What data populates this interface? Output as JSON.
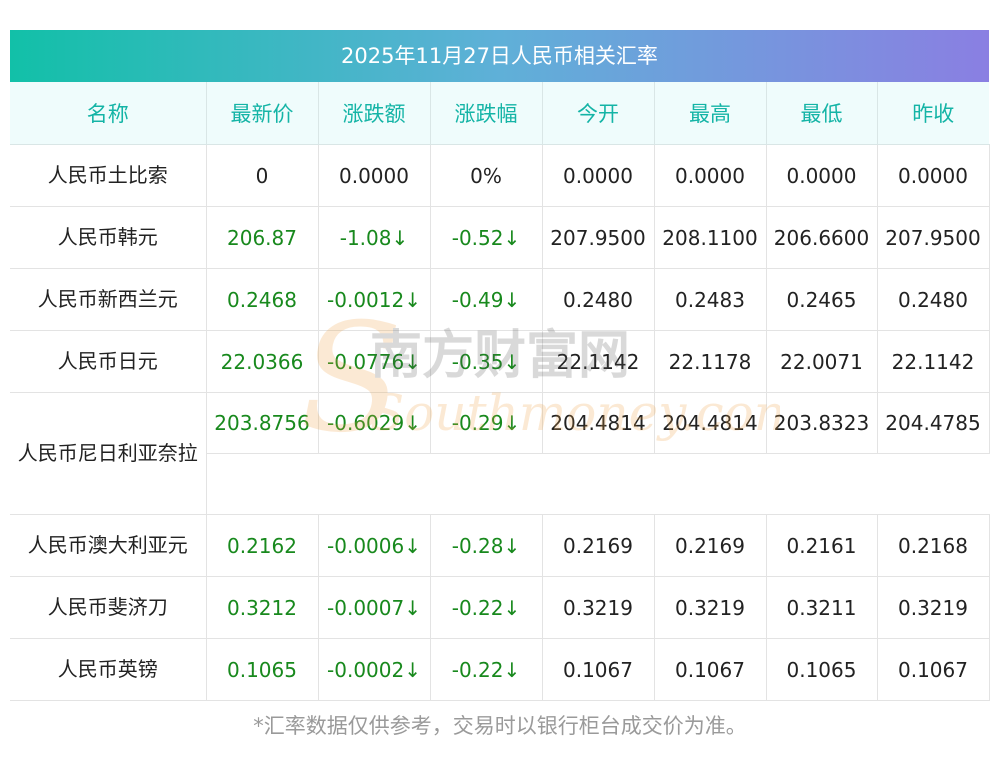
{
  "title": "2025年11月27日人民币相关汇率",
  "columns": [
    "名称",
    "最新价",
    "涨跌额",
    "涨跌幅",
    "今开",
    "最高",
    "最低",
    "昨收"
  ],
  "rows": [
    {
      "name": "人民币土比索",
      "latest": "0",
      "change": "0.0000",
      "pct": "0%",
      "open": "0.0000",
      "high": "0.0000",
      "low": "0.0000",
      "prev": "0.0000",
      "down": false
    },
    {
      "name": "人民币韩元",
      "latest": "206.87",
      "change": "-1.08↓",
      "pct": "-0.52↓",
      "open": "207.9500",
      "high": "208.1100",
      "low": "206.6600",
      "prev": "207.9500",
      "down": true
    },
    {
      "name": "人民币新西兰元",
      "latest": "0.2468",
      "change": "-0.0012↓",
      "pct": "-0.49↓",
      "open": "0.2480",
      "high": "0.2483",
      "low": "0.2465",
      "prev": "0.2480",
      "down": true
    },
    {
      "name": "人民币日元",
      "latest": "22.0366",
      "change": "-0.0776↓",
      "pct": "-0.35↓",
      "open": "22.1142",
      "high": "22.1178",
      "low": "22.0071",
      "prev": "22.1142",
      "down": true
    },
    {
      "name": "人民币尼日利亚奈拉",
      "latest": "203.8756",
      "change": "-0.6029↓",
      "pct": "-0.29↓",
      "open": "204.4814",
      "high": "204.4814",
      "low": "203.8323",
      "prev": "204.4785",
      "down": true
    },
    {
      "name": "人民币澳大利亚元",
      "latest": "0.2162",
      "change": "-0.0006↓",
      "pct": "-0.28↓",
      "open": "0.2169",
      "high": "0.2169",
      "low": "0.2161",
      "prev": "0.2168",
      "down": true
    },
    {
      "name": "人民币斐济刀",
      "latest": "0.3212",
      "change": "-0.0007↓",
      "pct": "-0.22↓",
      "open": "0.3219",
      "high": "0.3219",
      "low": "0.3211",
      "prev": "0.3219",
      "down": true
    },
    {
      "name": "人民币英镑",
      "latest": "0.1065",
      "change": "-0.0002↓",
      "pct": "-0.22↓",
      "open": "0.1067",
      "high": "0.1067",
      "low": "0.1065",
      "prev": "0.1067",
      "down": true
    }
  ],
  "watermark": {
    "cn": "南方财富网",
    "en": "Southmoney.com"
  },
  "footnote": "*汇率数据仅供参考，交易时以银行柜台成交价为准。",
  "colors": {
    "header_text": "#14b4a6",
    "down": "#18891d",
    "gradient_start": "#12c0a8",
    "gradient_end": "#8a7fe2"
  }
}
